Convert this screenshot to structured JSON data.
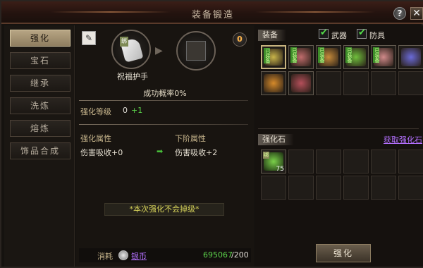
{
  "window": {
    "title": "装备锻造"
  },
  "buttons": {
    "help": "?",
    "close": "✕"
  },
  "sidebar": {
    "items": [
      {
        "label": "强化",
        "active": true
      },
      {
        "label": "宝石",
        "active": false
      },
      {
        "label": "继承",
        "active": false
      },
      {
        "label": "洗炼",
        "active": false
      },
      {
        "label": "熔炼",
        "active": false
      },
      {
        "label": "饰品合成",
        "active": false
      }
    ]
  },
  "center": {
    "item_name": "祝福护手",
    "bind_tag": "绑",
    "badge_count": "0",
    "success_rate": "成功概率0%",
    "level_label": "强化等级",
    "level_value": "0",
    "level_bonus": "+1",
    "attr_current_header": "强化属性",
    "attr_next_header": "下阶属性",
    "attr_current_value": "伤害吸收+0",
    "attr_next_value": "伤害吸收+2",
    "notice": "*本次强化不会掉级*",
    "cost_label": "消耗",
    "currency": "银币",
    "cost_have": "695067",
    "cost_need": "/200"
  },
  "right": {
    "equip_label": "装备",
    "filters": [
      {
        "label": "武器",
        "checked": true
      },
      {
        "label": "防具",
        "checked": true
      }
    ],
    "equip_items": [
      {
        "icon": "gauntlet",
        "tag": "已装备",
        "selected": true,
        "color": "#c9b54a"
      },
      {
        "icon": "boots",
        "tag": "已装备",
        "selected": false,
        "color": "#c06c6c"
      },
      {
        "icon": "scythe",
        "tag": "已装备",
        "selected": false,
        "color": "#c68b3a"
      },
      {
        "icon": "wings",
        "tag": "已装备",
        "selected": false,
        "color": "#6fbf3c"
      },
      {
        "icon": "armor",
        "tag": "已装备",
        "selected": false,
        "color": "#d08a8a"
      },
      {
        "icon": "staff",
        "tag": "",
        "selected": false,
        "color": "#6a6ad8"
      },
      {
        "icon": "bow",
        "tag": "",
        "selected": false,
        "color": "#d68a2a"
      },
      {
        "icon": "boots-2",
        "tag": "",
        "selected": false,
        "color": "#b44f5a"
      }
    ],
    "stone_label": "强化石",
    "get_stone_link": "获取强化石",
    "stones": [
      {
        "icon": "gem",
        "bind": "绑",
        "count": "75",
        "color": "#7bd14a"
      }
    ],
    "enhance_button": "强化"
  }
}
